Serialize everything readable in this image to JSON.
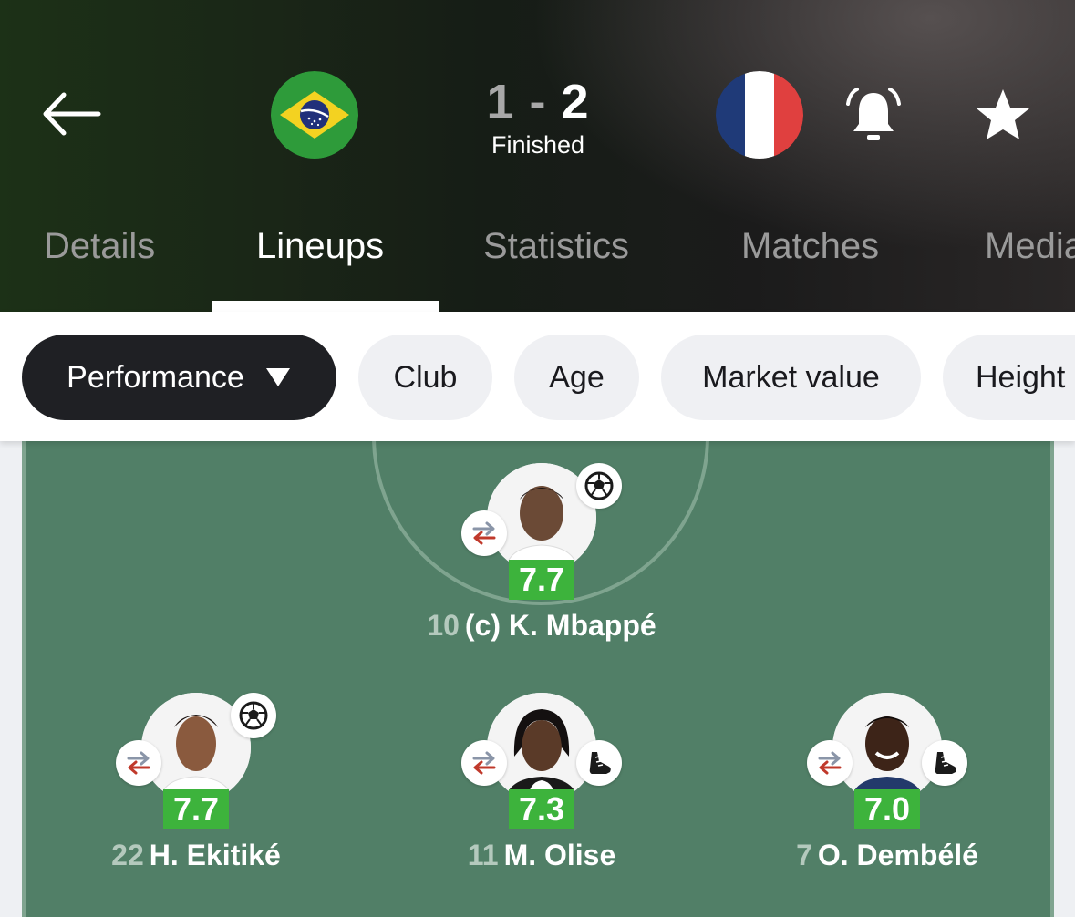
{
  "match": {
    "home_team": "Brazil",
    "away_team": "France",
    "home_score": "1",
    "away_score": "2",
    "separator": "-",
    "status": "Finished"
  },
  "header": {
    "icons": [
      "back-arrow-icon",
      "notification-bell-icon",
      "star-icon"
    ]
  },
  "tabs": [
    {
      "label": "Details",
      "active": false
    },
    {
      "label": "Lineups",
      "active": true
    },
    {
      "label": "Statistics",
      "active": false
    },
    {
      "label": "Matches",
      "active": false
    },
    {
      "label": "Media",
      "active": false
    }
  ],
  "filters": [
    {
      "label": "Performance",
      "selected": true
    },
    {
      "label": "Club",
      "selected": false
    },
    {
      "label": "Age",
      "selected": false
    },
    {
      "label": "Market value",
      "selected": false
    },
    {
      "label": "Height",
      "selected": false
    }
  ],
  "players": [
    {
      "number": "10",
      "name": "(c) K. Mbappé",
      "rating": "7.7",
      "event": "goal-ball-icon"
    },
    {
      "number": "22",
      "name": "H. Ekitiké",
      "rating": "7.7",
      "event": "goal-ball-icon"
    },
    {
      "number": "11",
      "name": "M. Olise",
      "rating": "7.3",
      "event": "boot-assist-icon"
    },
    {
      "number": "7",
      "name": "O. Dembélé",
      "rating": "7.0",
      "event": "boot-assist-icon"
    }
  ],
  "colors": {
    "pitch": "#517f67",
    "rating_bg": "#3db33c",
    "chip_selected": "#1f2024",
    "chip": "#eff0f3",
    "sub_out_arrow": "#c0392b"
  }
}
